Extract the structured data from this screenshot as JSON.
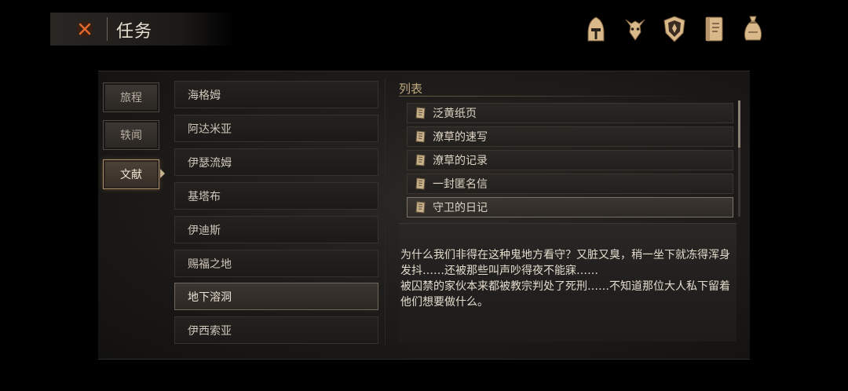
{
  "header": {
    "title": "任务",
    "close_icon": "close-x-icon",
    "close_color": "#e0682c"
  },
  "top_icons": [
    "helmet-icon",
    "horned-beast-icon",
    "shield-crest-icon",
    "journal-book-icon",
    "coin-bag-icon"
  ],
  "sidebar": {
    "tabs": [
      {
        "label": "旅程",
        "active": false
      },
      {
        "label": "轶闻",
        "active": false
      },
      {
        "label": "文献",
        "active": true
      }
    ]
  },
  "locations": [
    {
      "label": "海格姆",
      "selected": false
    },
    {
      "label": "阿达米亚",
      "selected": false
    },
    {
      "label": "伊瑟流姆",
      "selected": false
    },
    {
      "label": "基塔布",
      "selected": false
    },
    {
      "label": "伊迪斯",
      "selected": false
    },
    {
      "label": "赐福之地",
      "selected": false
    },
    {
      "label": "地下溶洞",
      "selected": true
    },
    {
      "label": "伊西索亚",
      "selected": false
    }
  ],
  "documents": {
    "header": "列表",
    "items": [
      {
        "label": "泛黄纸页",
        "icon": "scroll-icon",
        "selected": false
      },
      {
        "label": "潦草的速写",
        "icon": "scroll-icon",
        "selected": false
      },
      {
        "label": "潦草的记录",
        "icon": "scroll-icon",
        "selected": false
      },
      {
        "label": "一封匿名信",
        "icon": "scroll-icon",
        "selected": false
      },
      {
        "label": "守卫的日记",
        "icon": "scroll-icon",
        "selected": true
      }
    ]
  },
  "description": {
    "text": "为什么我们非得在这种鬼地方看守？又脏又臭，稍一坐下就冻得浑身发抖……还被那些叫声吵得夜不能寐……\n被囚禁的家伙本来都被教宗判处了死刑……不知道那位大人私下留着他们想要做什么。"
  },
  "colors": {
    "accent_gold": "#bfa87f",
    "icon_gold": "#d9b98a",
    "selected_border": "#a98f6e"
  }
}
